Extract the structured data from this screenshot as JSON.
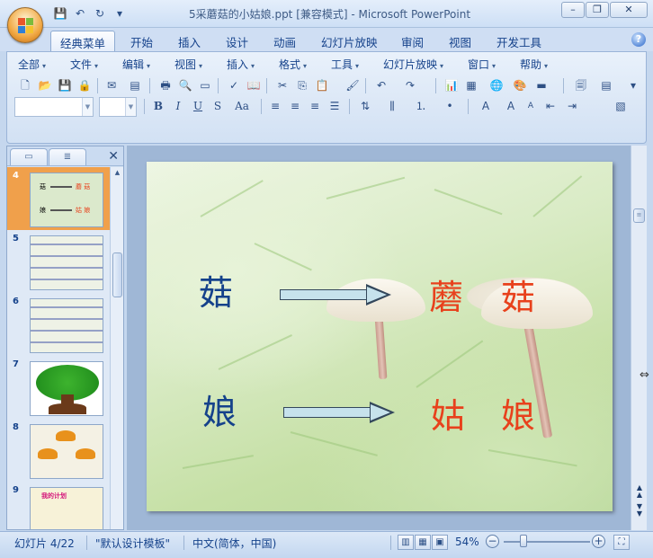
{
  "window": {
    "title": "5采蘑菇的小姑娘.ppt [兼容模式] - Microsoft PowerPoint",
    "buttons": {
      "minimize": "–",
      "restore": "❐",
      "close": "✕"
    }
  },
  "qat": {
    "save": "💾",
    "undo": "↶",
    "redo": "↻",
    "more": "▾"
  },
  "tabs": [
    "经典菜单",
    "开始",
    "插入",
    "设计",
    "动画",
    "幻灯片放映",
    "审阅",
    "视图",
    "开发工具"
  ],
  "menus": [
    "全部",
    "文件",
    "编辑",
    "视图",
    "插入",
    "格式",
    "工具",
    "幻灯片放映",
    "窗口",
    "帮助"
  ],
  "format_buttons": {
    "bold": "B",
    "italic": "I",
    "underline": "U",
    "strike": "S",
    "case": "Aa"
  },
  "thumbnails": {
    "numbers": [
      "4",
      "5",
      "6",
      "7",
      "8",
      "9"
    ],
    "slide4": {
      "top_left": "菇",
      "top_red": "蘑 菇",
      "bottom_left": "娘",
      "bottom_red": "姑 娘"
    },
    "slide9_text": "我的计划"
  },
  "slide": {
    "row1": {
      "left": "菇",
      "right_a": "蘑",
      "right_b": "菇"
    },
    "row2": {
      "left": "娘",
      "right_a": "姑",
      "right_b": "娘"
    },
    "colors": {
      "left_text": "#000000",
      "right_text": "#e8411c"
    }
  },
  "status": {
    "slide": "幻灯片 4/22",
    "template": "\"默认设计模板\"",
    "language": "中文(简体，中国)",
    "zoom": "54%",
    "zoom_out": "−",
    "zoom_in": "+"
  },
  "colors": {
    "accent": "#15428b",
    "selected_thumb": "#f0a04b"
  }
}
